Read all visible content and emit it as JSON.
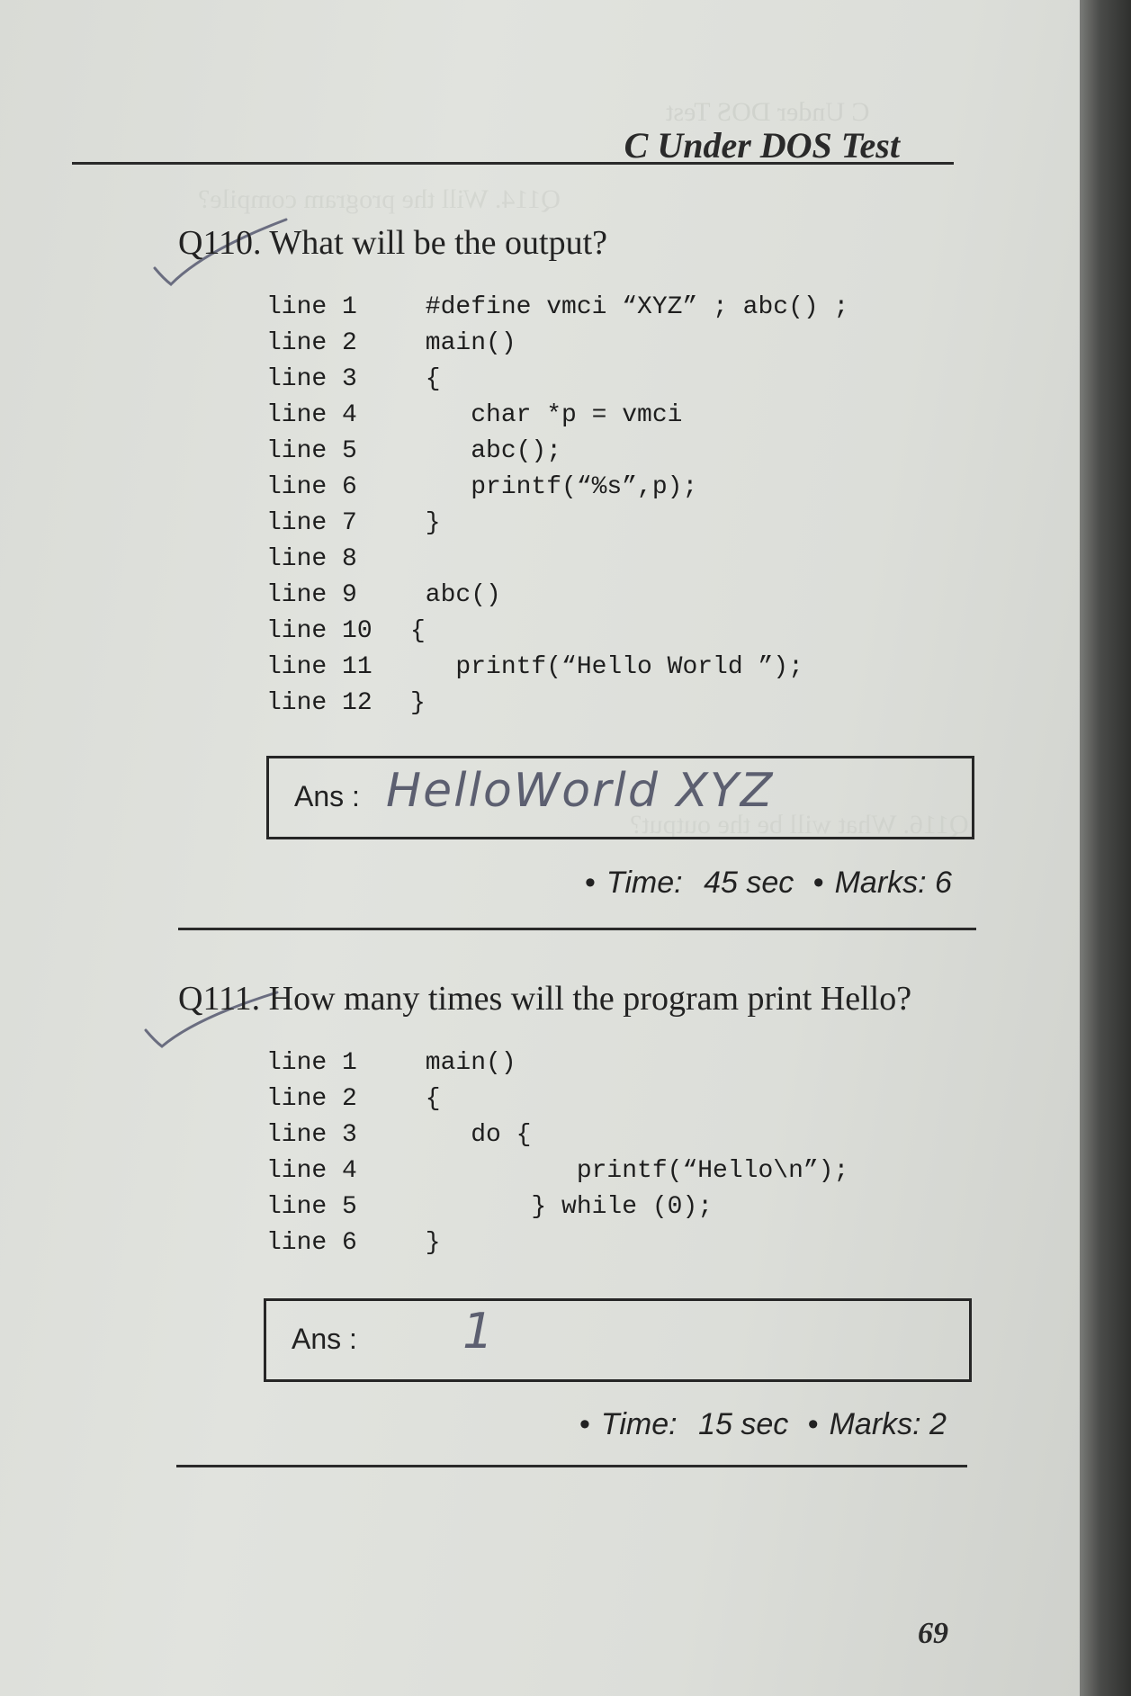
{
  "header": {
    "running_head": "C Under DOS Test",
    "page_number": "69"
  },
  "q110": {
    "question": "Q110. What will be the output?",
    "code": [
      {
        "ln": "line 1",
        "text": " #define vmci “XYZ” ; abc() ;"
      },
      {
        "ln": "line 2",
        "text": " main()"
      },
      {
        "ln": "line 3",
        "text": " {"
      },
      {
        "ln": "line 4",
        "text": "    char *p = vmci"
      },
      {
        "ln": "line 5",
        "text": "    abc();"
      },
      {
        "ln": "line 6",
        "text": "    printf(“%s”,p);"
      },
      {
        "ln": "line 7",
        "text": " }"
      },
      {
        "ln": "line 8",
        "text": ""
      },
      {
        "ln": "line 9",
        "text": " abc()"
      },
      {
        "ln": "line 10",
        "text": "{"
      },
      {
        "ln": "line 11",
        "text": "   printf(“Hello World ”);"
      },
      {
        "ln": "line 12",
        "text": "}"
      }
    ],
    "ans_label": "Ans :",
    "handwritten_answer": "HelloWorld XYZ",
    "time_label": "Time:",
    "time_value": "45 sec",
    "marks_label": "Marks: 6"
  },
  "q111": {
    "question": "Q111. How many times will the program print Hello?",
    "code": [
      {
        "ln": "line 1",
        "text": " main()"
      },
      {
        "ln": "line 2",
        "text": " {"
      },
      {
        "ln": "line 3",
        "text": "    do {"
      },
      {
        "ln": "line 4",
        "text": "           printf(“Hello\\n”);"
      },
      {
        "ln": "line 5",
        "text": "        } while (0);"
      },
      {
        "ln": "line 6",
        "text": " }"
      }
    ],
    "ans_label": "Ans :",
    "handwritten_answer": "1",
    "time_label": "Time:",
    "time_value": "15 sec",
    "marks_label": "Marks: 2"
  }
}
